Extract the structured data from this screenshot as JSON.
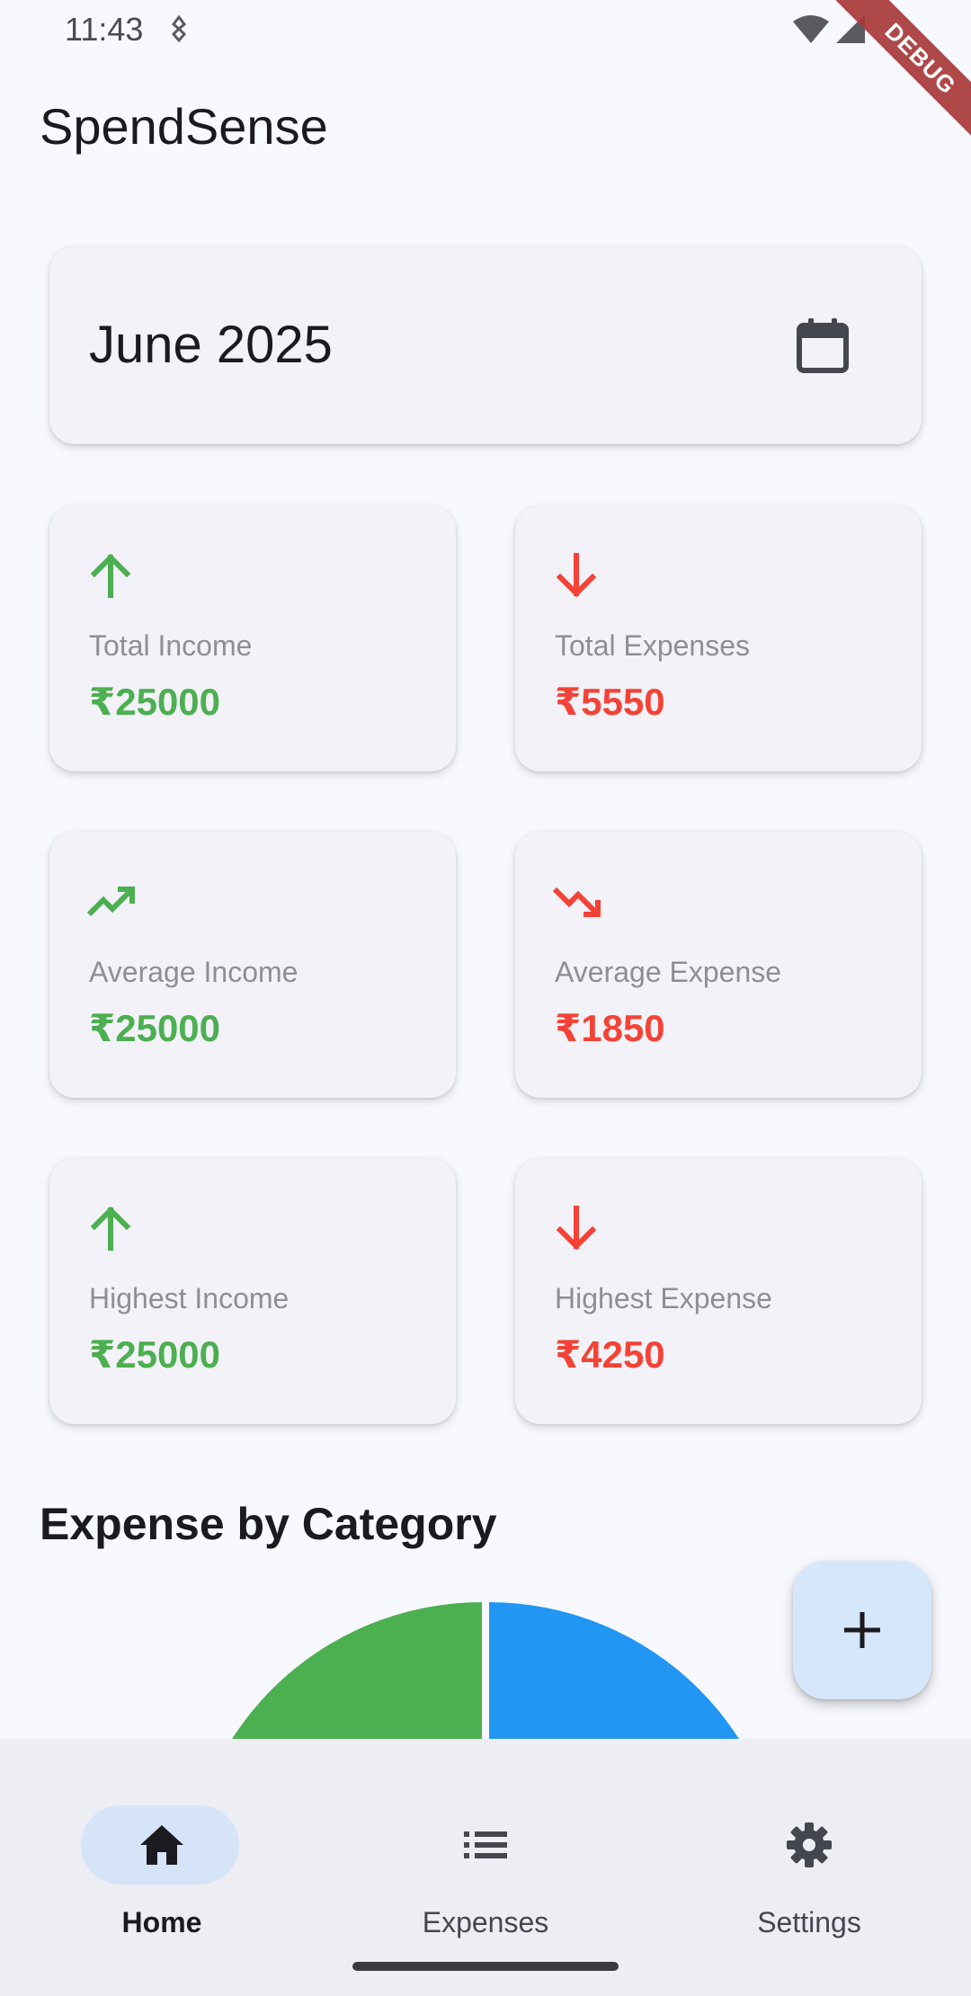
{
  "status_bar": {
    "time": "11:43",
    "icons": [
      "vibrate-icon",
      "wifi-icon",
      "signal-icon"
    ]
  },
  "debug_banner": "DEBUG",
  "app_bar": {
    "title": "SpendSense"
  },
  "month_selector": {
    "label": "June 2025",
    "icon": "calendar-icon"
  },
  "stats": {
    "total_income": {
      "label": "Total Income",
      "value": "₹25000",
      "icon": "arrow-up-icon"
    },
    "total_expenses": {
      "label": "Total Expenses",
      "value": "₹5550",
      "icon": "arrow-down-icon"
    },
    "average_income": {
      "label": "Average Income",
      "value": "₹25000",
      "icon": "trending-up-icon"
    },
    "average_expense": {
      "label": "Average Expense",
      "value": "₹1850",
      "icon": "trending-down-icon"
    },
    "highest_income": {
      "label": "Highest Income",
      "value": "₹25000",
      "icon": "arrow-up-icon"
    },
    "highest_expense": {
      "label": "Highest Expense",
      "value": "₹4250",
      "icon": "arrow-down-icon"
    }
  },
  "section": {
    "title": "Expense by Category"
  },
  "fab": {
    "icon": "plus-icon"
  },
  "bottom_nav": {
    "items": [
      {
        "label": "Home",
        "icon": "home-icon",
        "active": true
      },
      {
        "label": "Expenses",
        "icon": "list-icon",
        "active": false
      },
      {
        "label": "Settings",
        "icon": "gear-icon",
        "active": false
      }
    ]
  },
  "colors": {
    "income": "#4caf50",
    "expense": "#f44336",
    "pie_slice_1": "#4caf50",
    "pie_slice_2": "#2196f3",
    "fab_bg": "#d6e6fb",
    "nav_active_pill": "#d6e4f8"
  }
}
